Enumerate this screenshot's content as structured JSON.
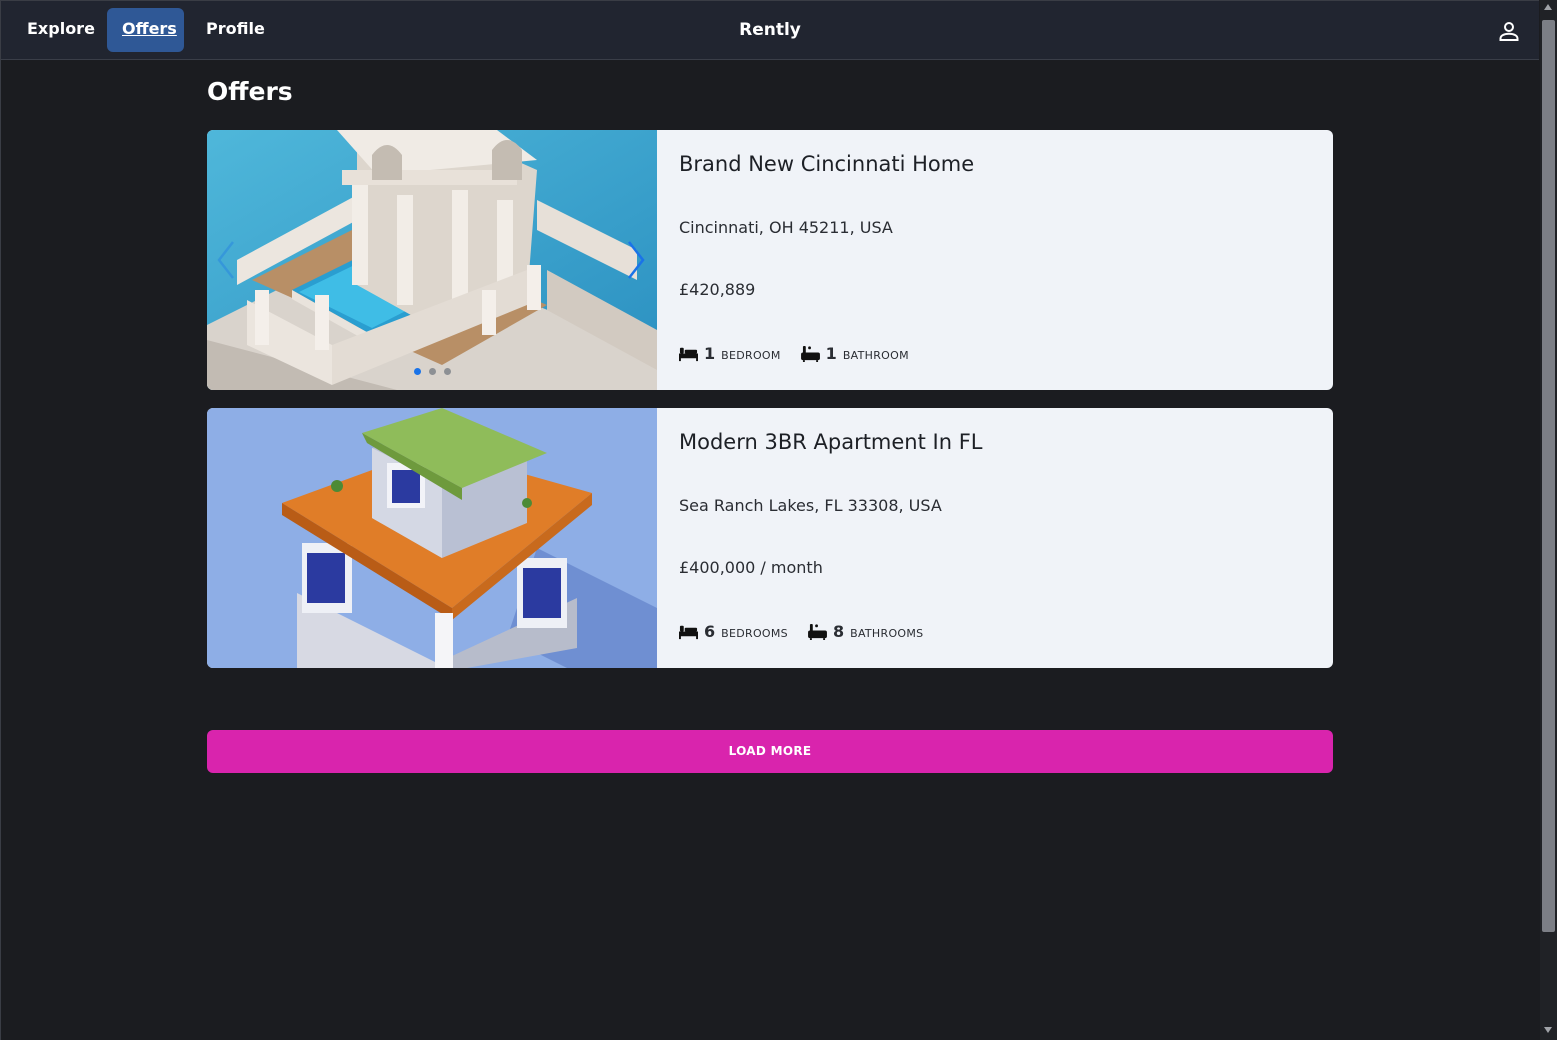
{
  "nav": {
    "items": [
      {
        "label": "Explore"
      },
      {
        "label": "Offers",
        "active": true
      },
      {
        "label": "Profile"
      }
    ],
    "brand": "Rently",
    "user_icon": "user-icon"
  },
  "page": {
    "title": "Offers"
  },
  "listings": [
    {
      "title": "Brand New Cincinnati Home",
      "address": "Cincinnati, OH 45211, USA",
      "price": "£420,889",
      "bedrooms": "1",
      "bedrooms_label": "Bedroom",
      "bathrooms": "1",
      "bathrooms_label": "Bathroom",
      "image_icon": "house-with-pool-image",
      "carousel_active_index": 0,
      "carousel_count": 3
    },
    {
      "title": "Modern 3BR Apartment In FL",
      "address": "Sea Ranch Lakes, FL 33308, USA",
      "price": "£400,000 / month",
      "bedrooms": "6",
      "bedrooms_label": "Bedrooms",
      "bathrooms": "8",
      "bathrooms_label": "Bathrooms",
      "image_icon": "isometric-house-image"
    }
  ],
  "load_more": {
    "label": "LOAD MORE"
  },
  "colors": {
    "background": "#1b1c20",
    "navbar": "#212530",
    "active_nav": "#2f5896",
    "card": "#f0f3f8",
    "load_more": "#d924ad",
    "carousel_accent": "#1a73e8"
  }
}
